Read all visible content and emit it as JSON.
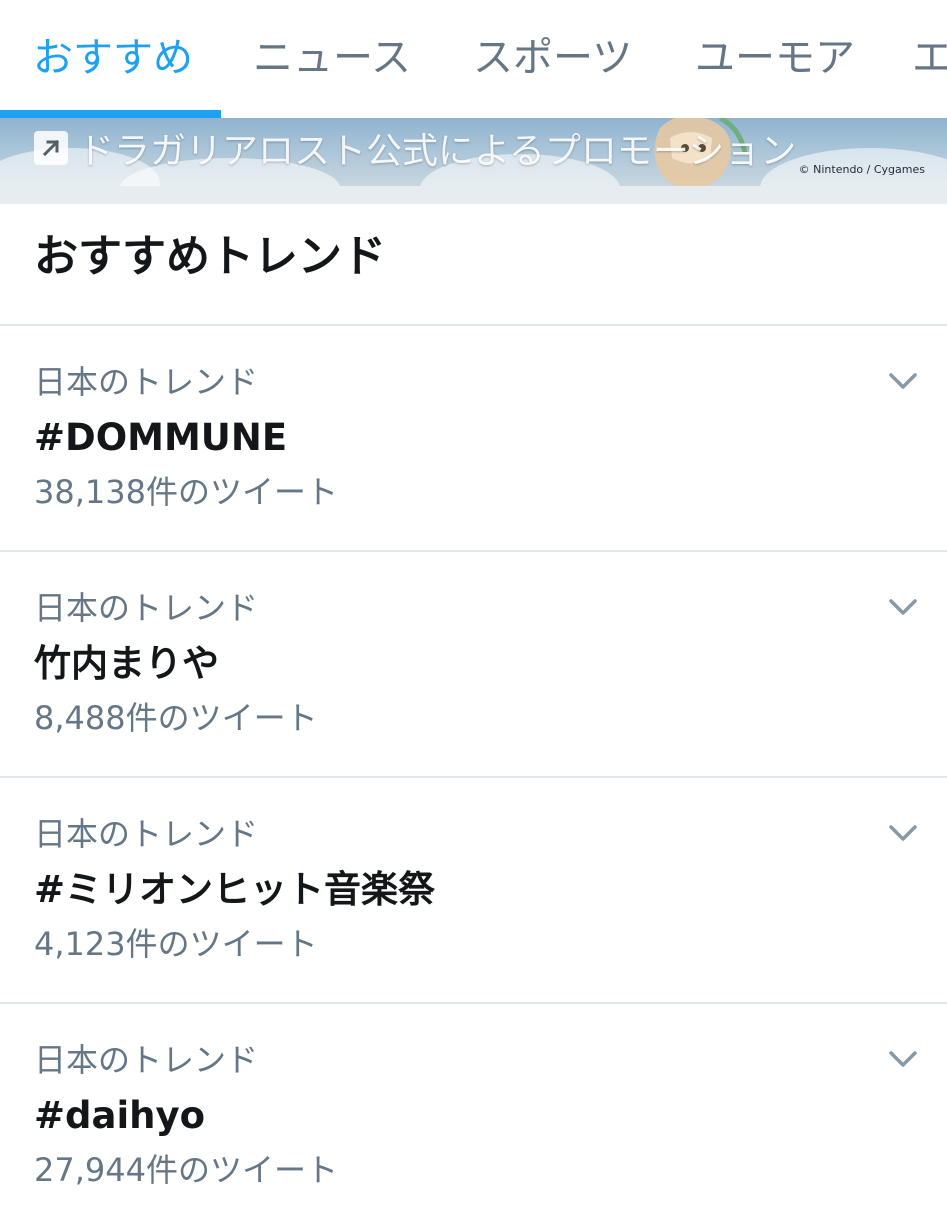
{
  "tabs": [
    {
      "label": "おすすめ",
      "active": true
    },
    {
      "label": "ニュース",
      "active": false
    },
    {
      "label": "スポーツ",
      "active": false
    },
    {
      "label": "ユーモア",
      "active": false
    },
    {
      "label": "エ",
      "active": false
    }
  ],
  "promo": {
    "label": "ドラガリアロスト公式によるプロモーション",
    "icon": "promoted-arrow-icon",
    "credit": "© Nintendo / Cygames"
  },
  "section": {
    "title": "おすすめトレンド"
  },
  "trends": [
    {
      "context": "日本のトレンド",
      "name": "#DOMMUNE",
      "count": "38,138件のツイート"
    },
    {
      "context": "日本のトレンド",
      "name": "竹内まりや",
      "count": "8,488件のツイート"
    },
    {
      "context": "日本のトレンド",
      "name": "#ミリオンヒット音楽祭",
      "count": "4,123件のツイート"
    },
    {
      "context": "日本のトレンド",
      "name": "#daihyo",
      "count": "27,944件のツイート"
    }
  ],
  "icons": {
    "chevron": "chevron-down-icon"
  },
  "colors": {
    "accent": "#1da1f2",
    "primary_text": "#14171a",
    "secondary_text": "#657786",
    "divider": "#e1e8ed"
  }
}
